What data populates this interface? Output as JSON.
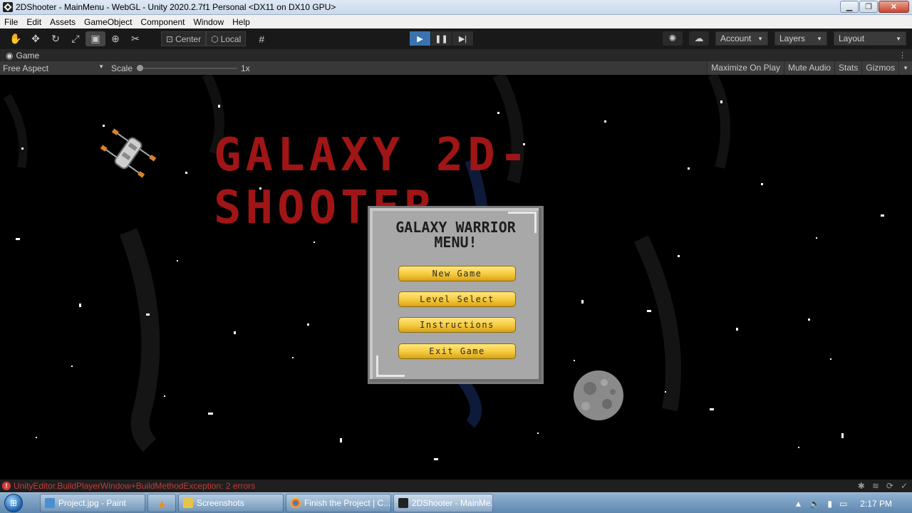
{
  "window": {
    "title": "2DShooter - MainMenu - WebGL - Unity 2020.2.7f1 Personal <DX11 on DX10 GPU>",
    "controls": [
      "minimize",
      "maximize",
      "close"
    ]
  },
  "menubar": [
    "File",
    "Edit",
    "Assets",
    "GameObject",
    "Component",
    "Window",
    "Help"
  ],
  "toolbar": {
    "tools": [
      "hand-icon",
      "move-icon",
      "rotate-icon",
      "scale-icon",
      "rect-icon",
      "transform-icon",
      "custom-tool-icon"
    ],
    "pivot": "Center",
    "space": "Local",
    "account": "Account",
    "layers": "Layers",
    "layout": "Layout"
  },
  "game_tab": {
    "label": "Game"
  },
  "game_bar": {
    "aspect": "Free Aspect",
    "scale_label": "Scale",
    "scale_value": "1x",
    "right_options": [
      "Maximize On Play",
      "Mute Audio",
      "Stats",
      "Gizmos"
    ]
  },
  "game": {
    "title": "GALAXY 2D-SHOOTER",
    "menu_heading_line1": "GALAXY WARRIOR",
    "menu_heading_line2": "MENU!",
    "buttons": {
      "new_game": "New Game",
      "level_select": "Level Select",
      "instructions": "Instructions",
      "exit_game": "Exit Game"
    },
    "colors": {
      "title": "#a01515",
      "button": "#f5c93b",
      "panel": "#a8a8a8"
    }
  },
  "status": {
    "error_text": "UnityEditor.BuildPlayerWindow+BuildMethodException: 2 errors"
  },
  "taskbar": {
    "tasks": [
      {
        "label": "Project.jpg - Paint"
      },
      {
        "label": ""
      },
      {
        "label": "Screenshots"
      },
      {
        "label": "Finish the Project | C..."
      },
      {
        "label": "2DShooter - MainMe..."
      }
    ],
    "clock": "2:17 PM"
  }
}
